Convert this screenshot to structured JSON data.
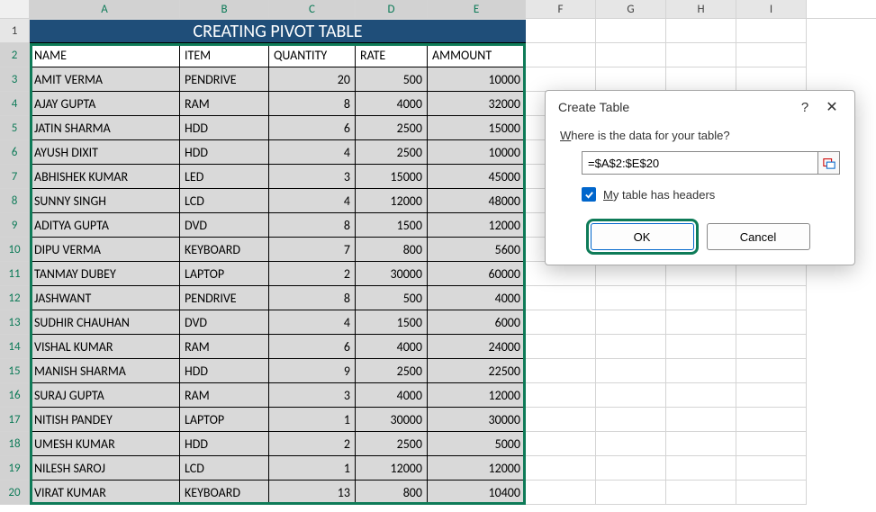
{
  "columns": [
    "A",
    "B",
    "C",
    "D",
    "E",
    "F",
    "G",
    "H",
    "I"
  ],
  "title": "CREATING PIVOT TABLE",
  "headers": [
    "NAME",
    "ITEM",
    "QUANTITY",
    "RATE",
    "AMMOUNT"
  ],
  "rows": [
    {
      "name": "AMIT VERMA",
      "item": "PENDRIVE",
      "qty": "20",
      "rate": "500",
      "amount": "10000"
    },
    {
      "name": "AJAY GUPTA",
      "item": "RAM",
      "qty": "8",
      "rate": "4000",
      "amount": "32000"
    },
    {
      "name": "JATIN SHARMA",
      "item": "HDD",
      "qty": "6",
      "rate": "2500",
      "amount": "15000"
    },
    {
      "name": "AYUSH DIXIT",
      "item": "HDD",
      "qty": "4",
      "rate": "2500",
      "amount": "10000"
    },
    {
      "name": "ABHISHEK KUMAR",
      "item": "LED",
      "qty": "3",
      "rate": "15000",
      "amount": "45000"
    },
    {
      "name": "SUNNY SINGH",
      "item": "LCD",
      "qty": "4",
      "rate": "12000",
      "amount": "48000"
    },
    {
      "name": "ADITYA GUPTA",
      "item": "DVD",
      "qty": "8",
      "rate": "1500",
      "amount": "12000"
    },
    {
      "name": "DIPU VERMA",
      "item": "KEYBOARD",
      "qty": "7",
      "rate": "800",
      "amount": "5600"
    },
    {
      "name": "TANMAY DUBEY",
      "item": "LAPTOP",
      "qty": "2",
      "rate": "30000",
      "amount": "60000"
    },
    {
      "name": "JASHWANT",
      "item": "PENDRIVE",
      "qty": "8",
      "rate": "500",
      "amount": "4000"
    },
    {
      "name": "SUDHIR CHAUHAN",
      "item": "DVD",
      "qty": "4",
      "rate": "1500",
      "amount": "6000"
    },
    {
      "name": "VISHAL KUMAR",
      "item": "RAM",
      "qty": "6",
      "rate": "4000",
      "amount": "24000"
    },
    {
      "name": "MANISH SHARMA",
      "item": "HDD",
      "qty": "9",
      "rate": "2500",
      "amount": "22500"
    },
    {
      "name": "SURAJ GUPTA",
      "item": "RAM",
      "qty": "3",
      "rate": "4000",
      "amount": "12000"
    },
    {
      "name": "NITISH PANDEY",
      "item": "LAPTOP",
      "qty": "1",
      "rate": "30000",
      "amount": "30000"
    },
    {
      "name": "UMESH KUMAR",
      "item": "HDD",
      "qty": "2",
      "rate": "2500",
      "amount": "5000"
    },
    {
      "name": "NILESH SAROJ",
      "item": "LCD",
      "qty": "1",
      "rate": "12000",
      "amount": "12000"
    },
    {
      "name": "VIRAT KUMAR",
      "item": "KEYBOARD",
      "qty": "13",
      "rate": "800",
      "amount": "10400"
    }
  ],
  "dialog": {
    "title": "Create Table",
    "question": "Where is the data for your table?",
    "range": "=$A$2:$E$20",
    "checkbox_label": "My table has headers",
    "ok": "OK",
    "cancel": "Cancel",
    "help": "?",
    "close": "✕"
  }
}
